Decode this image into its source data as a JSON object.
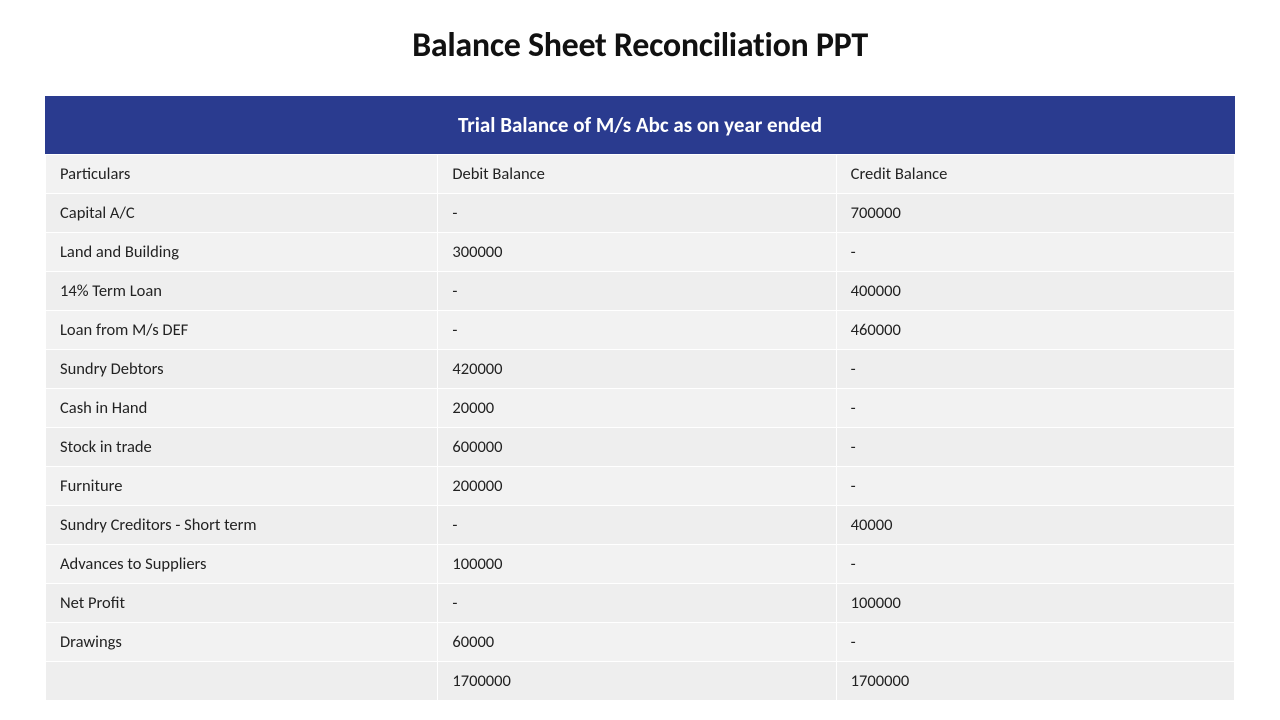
{
  "title": "Balance Sheet Reconciliation PPT",
  "table": {
    "header": "Trial Balance of M/s Abc as on year ended",
    "columns": {
      "particulars": "Particulars",
      "debit": "Debit Balance",
      "credit": "Credit Balance"
    },
    "rows": [
      {
        "particulars": "Capital A/C",
        "debit": "-",
        "credit": "700000"
      },
      {
        "particulars": "Land and Building",
        "debit": "300000",
        "credit": "-"
      },
      {
        "particulars": "14% Term Loan",
        "debit": "-",
        "credit": "400000"
      },
      {
        "particulars": "Loan from M/s DEF",
        "debit": "-",
        "credit": "460000"
      },
      {
        "particulars": "Sundry Debtors",
        "debit": "420000",
        "credit": "-"
      },
      {
        "particulars": "Cash in Hand",
        "debit": "20000",
        "credit": "-"
      },
      {
        "particulars": "Stock in trade",
        "debit": "600000",
        "credit": "-"
      },
      {
        "particulars": "Furniture",
        "debit": "200000",
        "credit": "-"
      },
      {
        "particulars": "Sundry Creditors - Short term",
        "debit": "-",
        "credit": "40000"
      },
      {
        "particulars": "Advances to Suppliers",
        "debit": "100000",
        "credit": "-"
      },
      {
        "particulars": "Net Profit",
        "debit": "-",
        "credit": "100000"
      },
      {
        "particulars": "Drawings",
        "debit": "60000",
        "credit": "-"
      }
    ],
    "totals": {
      "particulars": "",
      "debit": "1700000",
      "credit": "1700000"
    }
  },
  "chart_data": {
    "type": "table",
    "title": "Trial Balance of M/s Abc as on year ended",
    "columns": [
      "Particulars",
      "Debit Balance",
      "Credit Balance"
    ],
    "rows": [
      [
        "Capital A/C",
        null,
        700000
      ],
      [
        "Land and Building",
        300000,
        null
      ],
      [
        "14% Term Loan",
        null,
        400000
      ],
      [
        "Loan from M/s DEF",
        null,
        460000
      ],
      [
        "Sundry Debtors",
        420000,
        null
      ],
      [
        "Cash in Hand",
        20000,
        null
      ],
      [
        "Stock in trade",
        600000,
        null
      ],
      [
        "Furniture",
        200000,
        null
      ],
      [
        "Sundry Creditors - Short term",
        null,
        40000
      ],
      [
        "Advances to Suppliers",
        100000,
        null
      ],
      [
        "Net Profit",
        null,
        100000
      ],
      [
        "Drawings",
        60000,
        null
      ]
    ],
    "totals": [
      null,
      1700000,
      1700000
    ]
  }
}
